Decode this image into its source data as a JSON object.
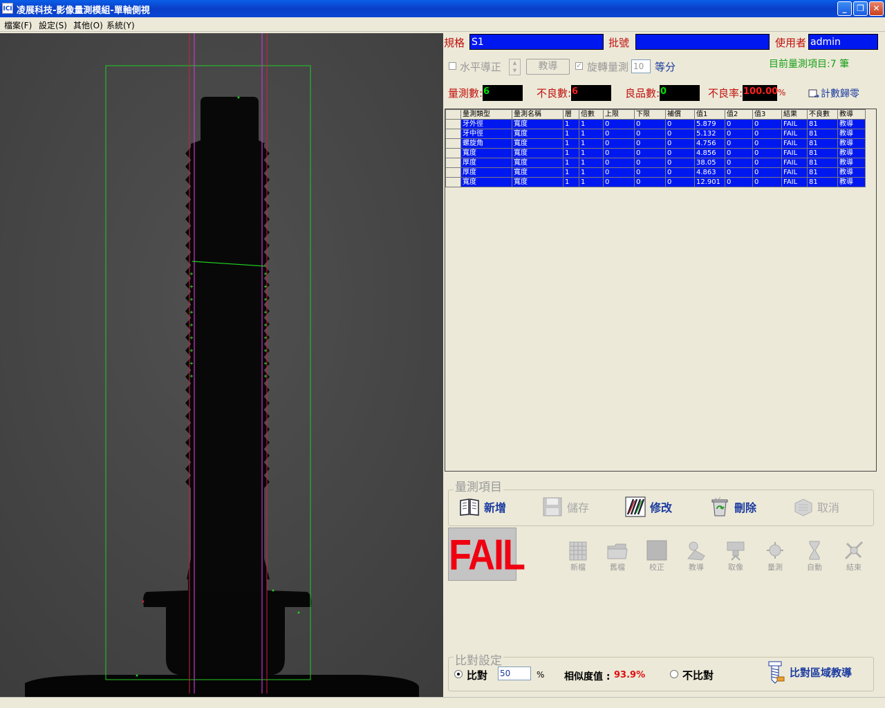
{
  "window": {
    "title": "凌展科技-影像量測模組-單軸側視",
    "minimize": "_",
    "restore": "❐",
    "close": "✕",
    "app_icon": "ICI"
  },
  "menu": [
    "檔案(F)",
    "設定(S)",
    "其他(O)",
    "系統(Y)"
  ],
  "header": {
    "spec_label": "規格",
    "spec_value": "S1",
    "batch_label": "批號",
    "batch_value": "",
    "user_label": "使用者",
    "user_value": "admin"
  },
  "options": {
    "level_label": "水平導正",
    "teach_button": "教導",
    "rotate_label": "旋轉量測",
    "rotate_value": "10",
    "equal_label": "等分",
    "item_count": "目前量測項目:7 筆"
  },
  "counts": {
    "measure_label": "量測數:",
    "measure_value": "6",
    "defect_label": "不良數:",
    "defect_value": "6",
    "good_label": "良品數:",
    "good_value": "0",
    "rate_label": "不良率:",
    "rate_value": "100.00",
    "rate_unit": "%",
    "reset_label": "計數歸零"
  },
  "table": {
    "columns": [
      "量測類型",
      "量測名稱",
      "層",
      "倍數",
      "上限",
      "下限",
      "補償",
      "值1",
      "值2",
      "值3",
      "結果",
      "不良數",
      "教導"
    ],
    "rows": [
      [
        "牙外徑",
        "寬度",
        "1",
        "1",
        "0",
        "0",
        "0",
        "5.879",
        "0",
        "0",
        "FAIL",
        "81",
        "教導"
      ],
      [
        "牙中徑",
        "寬度",
        "1",
        "1",
        "0",
        "0",
        "0",
        "5.132",
        "0",
        "0",
        "FAIL",
        "81",
        "教導"
      ],
      [
        "螺旋角",
        "寬度",
        "1",
        "1",
        "0",
        "0",
        "0",
        "4.756",
        "0",
        "0",
        "FAIL",
        "81",
        "教導"
      ],
      [
        "寬度",
        "寬度",
        "1",
        "1",
        "0",
        "0",
        "0",
        "4.856",
        "0",
        "0",
        "FAIL",
        "81",
        "教導"
      ],
      [
        "厚度",
        "寬度",
        "1",
        "1",
        "0",
        "0",
        "0",
        "38.05",
        "0",
        "0",
        "FAIL",
        "81",
        "教導"
      ],
      [
        "厚度",
        "寬度",
        "1",
        "1",
        "0",
        "0",
        "0",
        "4.863",
        "0",
        "0",
        "FAIL",
        "81",
        "教導"
      ],
      [
        "寬度",
        "寬度",
        "1",
        "1",
        "0",
        "0",
        "0",
        "12.901",
        "0",
        "0",
        "FAIL",
        "81",
        "教導"
      ]
    ]
  },
  "items_group": {
    "title": "量測項目",
    "add": "新增",
    "save": "儲存",
    "edit": "修改",
    "delete": "刪除",
    "cancel": "取消"
  },
  "result": "FAIL",
  "tools": [
    "新檔",
    "舊檔",
    "校正",
    "教導",
    "取像",
    "量測",
    "自動",
    "結束"
  ],
  "compare": {
    "title": "比對設定",
    "compare_label": "比對",
    "compare_value": "50",
    "percent": "%",
    "similarity_label": "相似度值 :",
    "similarity_value": "93.9%",
    "no_compare_label": "不比對",
    "region_teach": "比對區域教導"
  },
  "colors": {
    "title_blue": "#0a3fc8",
    "field_blue": "#0018f0",
    "label_red": "#c0100c",
    "fail_red": "#f00010",
    "roi_green": "#22cc22",
    "line_magenta": "#cc33cc"
  }
}
